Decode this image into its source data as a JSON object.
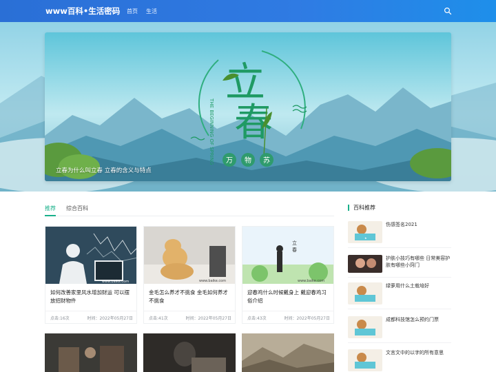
{
  "header": {
    "site_title": "www百科•生活密码",
    "nav": [
      {
        "label": "首页"
      },
      {
        "label": "生活"
      }
    ],
    "search_icon": "search-icon"
  },
  "banner": {
    "caption": "立春为什么叫立春 立春的含义与特点",
    "art": {
      "main_char_top": "立",
      "main_char_bottom": "春",
      "english": "THE BEGINNING OF SPRING",
      "seal_chars": [
        "万",
        "物",
        "苏"
      ]
    }
  },
  "tabs": [
    {
      "label": "推荐",
      "active": true
    },
    {
      "label": "综合百科",
      "active": false
    }
  ],
  "cards": [
    {
      "title": "如何改善家里风水增加财运 可以摆放招财物件",
      "hits_label": "点击:16次",
      "date_label": "时间：2022年05月27日",
      "watermark": "www.baike.com"
    },
    {
      "title": "金毛怎么养才不挑食 金毛如何养才不挑食",
      "hits_label": "点击:41次",
      "date_label": "时间：2022年05月27日",
      "watermark": "www.baike.com"
    },
    {
      "title": "迎春鸡什么时候戴身上 戴迎春鸡习俗介绍",
      "hits_label": "点击:43次",
      "date_label": "时间：2022年05月27日",
      "watermark": "www.baike.com"
    }
  ],
  "sidebar": {
    "heading": "百科推荐",
    "items": [
      {
        "title": "伤感签名2021"
      },
      {
        "title": "护肤小技巧有哪些 日常美容护肤有哪些小窍门"
      },
      {
        "title": "绿萝用什么土栽培好"
      },
      {
        "title": "成都科技馆怎么预约门票"
      },
      {
        "title": "文言文中的以字的所有意思"
      }
    ]
  },
  "colors": {
    "header": "#2a6fd6",
    "accent": "#19b08a",
    "banner_text": "#2a9a6a"
  }
}
